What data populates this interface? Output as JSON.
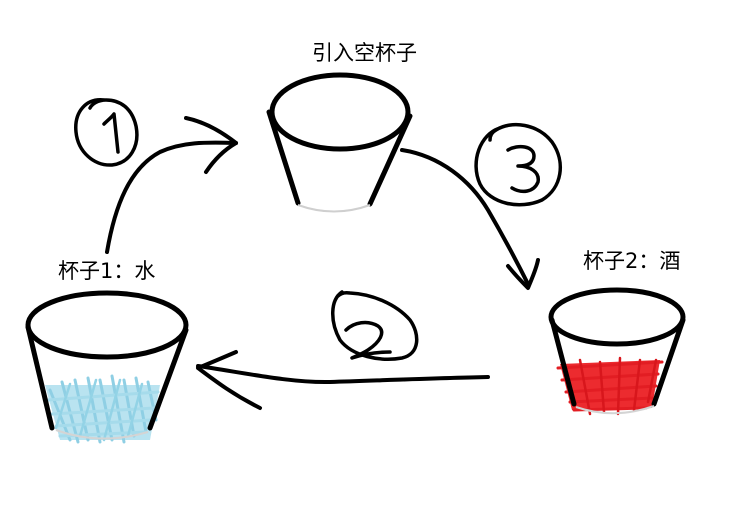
{
  "labels": {
    "empty_cup": "引入空杯子",
    "cup1": "杯子1：水",
    "cup2": "杯子2：酒"
  },
  "colors": {
    "ink": "#000000",
    "water": "#9fd8ea",
    "wine": "#e8232a"
  },
  "steps": [
    {
      "number": "1",
      "meaning": "step-1-arrow"
    },
    {
      "number": "2",
      "meaning": "step-2-arrow"
    },
    {
      "number": "3",
      "meaning": "step-3-arrow"
    }
  ]
}
